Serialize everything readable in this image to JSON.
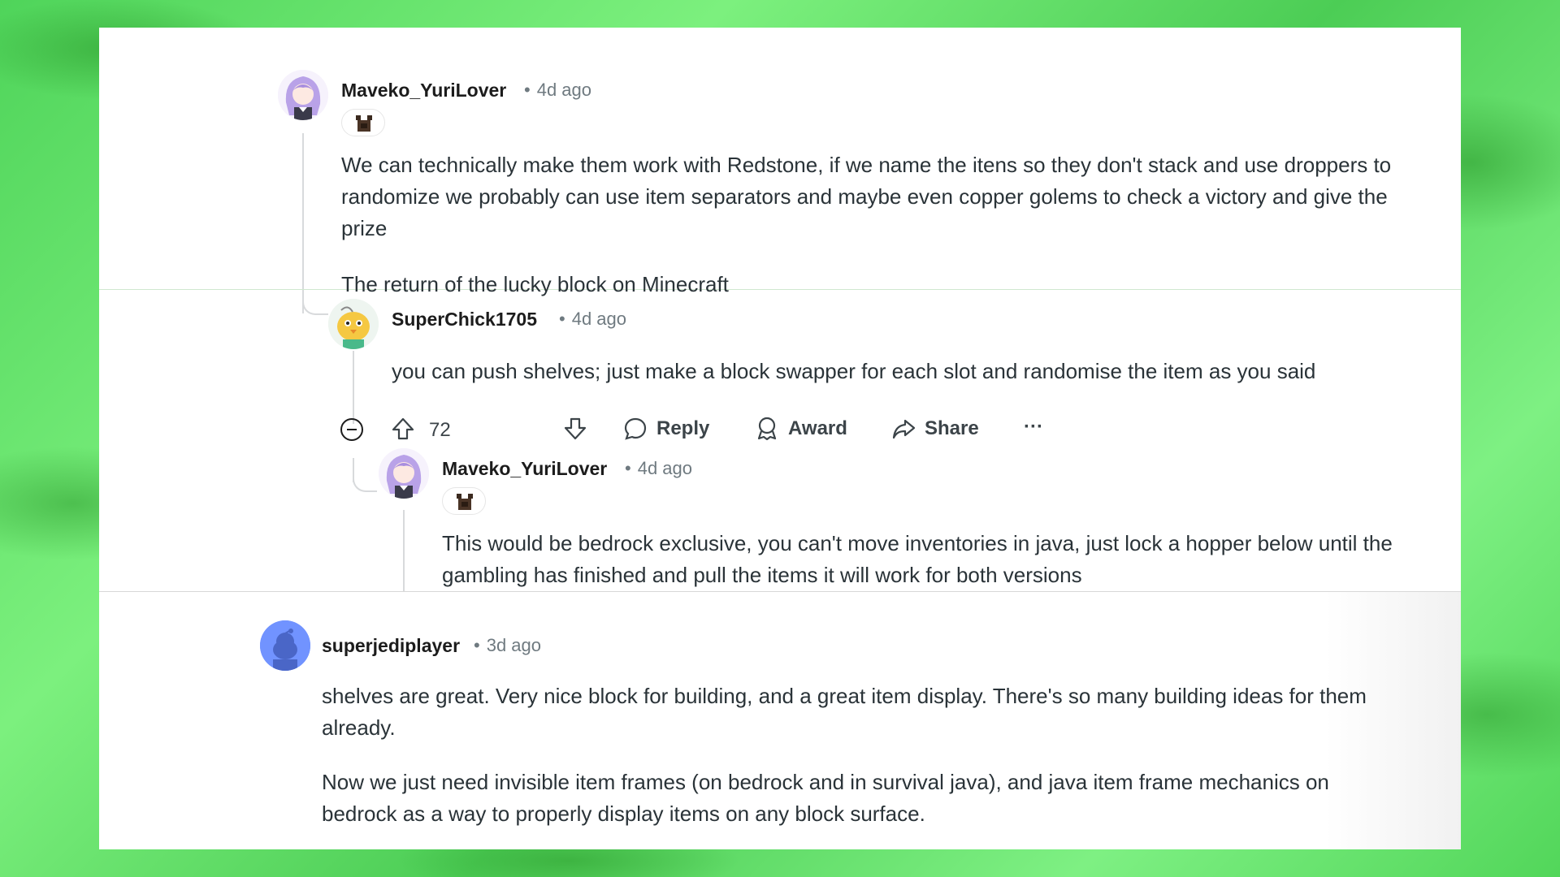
{
  "comments": [
    {
      "author": "Maveko_YuriLover",
      "time": "4d ago",
      "paragraphs": [
        "We can technically make them work with Redstone, if we name the itens so they don't stack and use droppers to randomize we probably can use item separators and maybe even copper golems to check a victory and give the prize",
        "The return of the lucky block on Minecraft"
      ]
    },
    {
      "author": "SuperChick1705",
      "time": "4d ago",
      "paragraphs": [
        "you can push shelves; just make a block swapper for each slot and randomise the item as you said"
      ],
      "actions": {
        "score": "72",
        "reply": "Reply",
        "award": "Award",
        "share": "Share",
        "more": "···"
      }
    },
    {
      "author": "Maveko_YuriLover",
      "time": "4d ago",
      "paragraphs": [
        "This would be bedrock exclusive, you can't move inventories in java, just lock a hopper below until the gambling has finished and pull the items it will work for both versions"
      ]
    },
    {
      "author": "superjediplayer",
      "time": "3d ago",
      "paragraphs": [
        "shelves are great. Very nice block for building, and a great item display. There's so many building ideas for them already.",
        "Now we just need invisible item frames (on bedrock and in survival java), and java item frame mechanics on bedrock as a way to properly display items on any block surface."
      ]
    }
  ],
  "separator": "•",
  "colors": {
    "background_green": "#5fe066",
    "text": "#2a3338",
    "meta": "#6f7a80",
    "thread_line": "#d8dadc",
    "default_avatar": "#7193ff"
  },
  "icons": [
    "anime-avatar-icon",
    "chick-avatar-icon",
    "reddit-snoo-avatar-icon",
    "flair-icon",
    "collapse-icon",
    "upvote-icon",
    "downvote-icon",
    "comment-icon",
    "award-icon",
    "share-icon",
    "more-icon"
  ]
}
